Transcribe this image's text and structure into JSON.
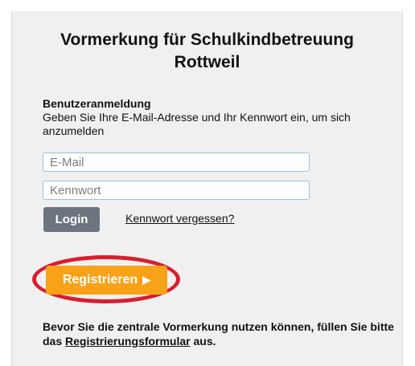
{
  "header": {
    "title_line1": "Vormerkung für Schulkindbetreuung",
    "title_line2": "Rottweil"
  },
  "login": {
    "heading": "Benutzeranmeldung",
    "description": "Geben Sie Ihre E-Mail-Adresse und Ihr Kennwort ein, um sich anzumelden",
    "email_placeholder": "E-Mail",
    "password_placeholder": "Kennwort",
    "login_button": "Login",
    "forgot_password_link": "Kennwort vergessen?"
  },
  "register": {
    "button_label": "Registrieren",
    "button_arrow": "▶",
    "button_color": "#f7a217",
    "highlight_color": "#d91e2e",
    "info_before": "Bevor Sie die zentrale Vormerkung nutzen können, füllen Sie bitte das ",
    "info_link": "Registrierungsformular",
    "info_after": " aus."
  },
  "colors": {
    "panel_background": "#f0f0f0",
    "login_button": "#6c757d",
    "input_border": "#9dbce8"
  }
}
